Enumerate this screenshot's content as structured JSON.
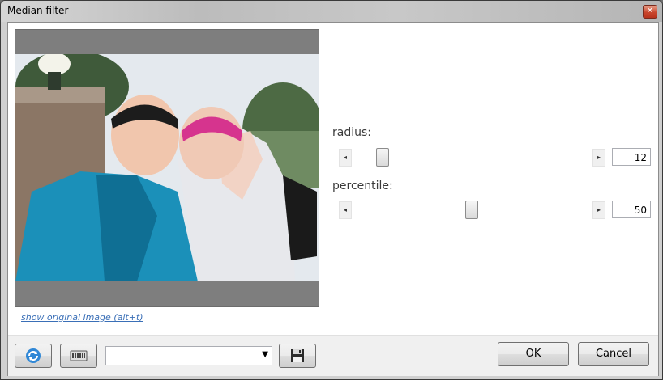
{
  "window": {
    "title": "Median filter"
  },
  "preview": {
    "link": "show original image (alt+t)"
  },
  "params": {
    "radius": {
      "label": "radius:",
      "value": "12",
      "fraction": 0.1
    },
    "percentile": {
      "label": "percentile:",
      "value": "50",
      "fraction": 0.5
    }
  },
  "footer": {
    "preset_value": "",
    "ok_label": "OK",
    "cancel_label": "Cancel"
  },
  "icons": {
    "reset": "refresh-icon",
    "keyboard": "keyboard-icon",
    "save": "floppy-disk-icon",
    "close": "close-icon"
  }
}
